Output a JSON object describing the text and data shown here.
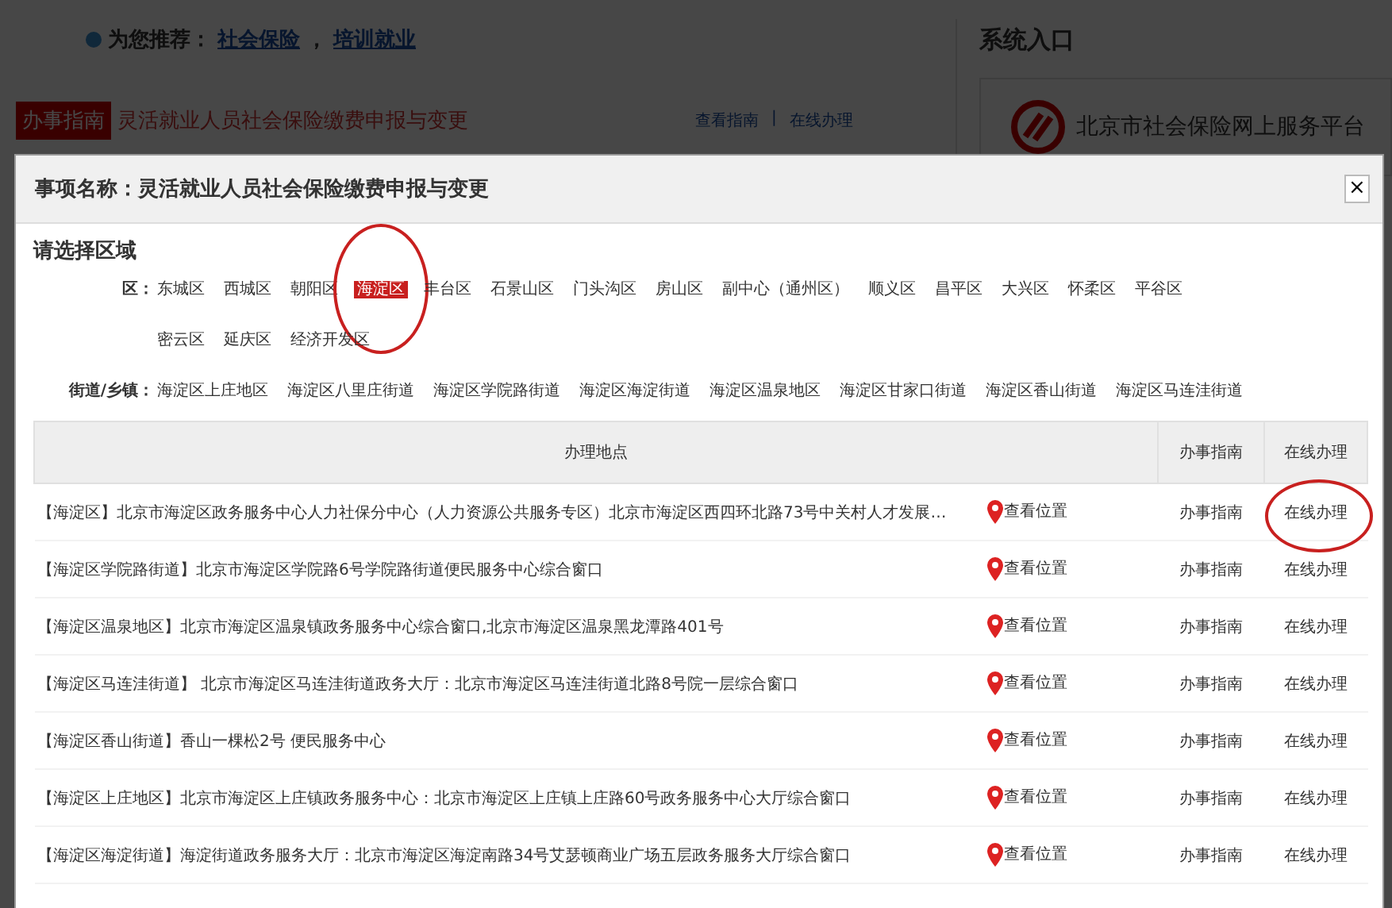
{
  "background": {
    "recommend_label": "为您推荐：",
    "recommend_links": [
      "社会保险",
      "培训就业"
    ],
    "recommend_separator": "，",
    "action_separator": "|",
    "badge": "办事指南",
    "item_title": "灵活就业人员社会保险缴费申报与变更",
    "actions": [
      "查看指南",
      "在线办理"
    ],
    "side_title": "系统入口",
    "side_logo_text": "北京市社会保险网上服务平台"
  },
  "dialog": {
    "title": "事项名称：灵活就业人员社会保险缴费申报与变更",
    "close": "×",
    "region_heading": "请选择区域",
    "district_label": "区：",
    "districts": [
      {
        "label": "东城区",
        "selected": false,
        "circled": false
      },
      {
        "label": "西城区",
        "selected": false,
        "circled": false
      },
      {
        "label": "朝阳区",
        "selected": false,
        "circled": false
      },
      {
        "label": "海淀区",
        "selected": true,
        "circled": true
      },
      {
        "label": "丰台区",
        "selected": false,
        "circled": false
      },
      {
        "label": "石景山区",
        "selected": false,
        "circled": false
      },
      {
        "label": "门头沟区",
        "selected": false,
        "circled": false
      },
      {
        "label": "房山区",
        "selected": false,
        "circled": false
      },
      {
        "label": "副中心（通州区）",
        "selected": false,
        "circled": false
      },
      {
        "label": "顺义区",
        "selected": false,
        "circled": false
      },
      {
        "label": "昌平区",
        "selected": false,
        "circled": false
      },
      {
        "label": "大兴区",
        "selected": false,
        "circled": false
      },
      {
        "label": "怀柔区",
        "selected": false,
        "circled": false
      },
      {
        "label": "平谷区",
        "selected": false,
        "circled": false
      },
      {
        "label": "密云区",
        "selected": false,
        "circled": false
      },
      {
        "label": "延庆区",
        "selected": false,
        "circled": false
      },
      {
        "label": "经济开发区",
        "selected": false,
        "circled": false
      }
    ],
    "street_label": "街道/乡镇：",
    "streets": [
      "海淀区上庄地区",
      "海淀区八里庄街道",
      "海淀区学院路街道",
      "海淀区海淀街道",
      "海淀区温泉地区",
      "海淀区甘家口街道",
      "海淀区香山街道",
      "海淀区马连洼街道"
    ],
    "table": {
      "columns": [
        "办理地点",
        "办事指南",
        "在线办理"
      ],
      "rows": [
        {
          "location": "【海淀区】北京市海淀区政务服务中心人力社保分中心（人力资源公共服务专区）北京市海淀区西四环北路73号中关村人才发展…",
          "map_link": "查看位置",
          "guide": "办事指南",
          "online": "在线办理",
          "circled": true
        },
        {
          "location": "【海淀区学院路街道】北京市海淀区学院路6号学院路街道便民服务中心综合窗口",
          "map_link": "查看位置",
          "guide": "办事指南",
          "online": "在线办理",
          "circled": false
        },
        {
          "location": "【海淀区温泉地区】北京市海淀区温泉镇政务服务中心综合窗口,北京市海淀区温泉黑龙潭路401号",
          "map_link": "查看位置",
          "guide": "办事指南",
          "online": "在线办理",
          "circled": false
        },
        {
          "location": "【海淀区马连洼街道】 北京市海淀区马连洼街道政务大厅：北京市海淀区马连洼街道北路8号院一层综合窗口",
          "map_link": "查看位置",
          "guide": "办事指南",
          "online": "在线办理",
          "circled": false
        },
        {
          "location": "【海淀区香山街道】香山一棵松2号 便民服务中心",
          "map_link": "查看位置",
          "guide": "办事指南",
          "online": "在线办理",
          "circled": false
        },
        {
          "location": "【海淀区上庄地区】北京市海淀区上庄镇政务服务中心：北京市海淀区上庄镇上庄路60号政务服务中心大厅综合窗口",
          "map_link": "查看位置",
          "guide": "办事指南",
          "online": "在线办理",
          "circled": false
        },
        {
          "location": "【海淀区海淀街道】海淀街道政务服务大厅：北京市海淀区海淀南路34号艾瑟顿商业广场五层政务服务大厅综合窗口",
          "map_link": "查看位置",
          "guide": "办事指南",
          "online": "在线办理",
          "circled": false
        }
      ]
    }
  }
}
